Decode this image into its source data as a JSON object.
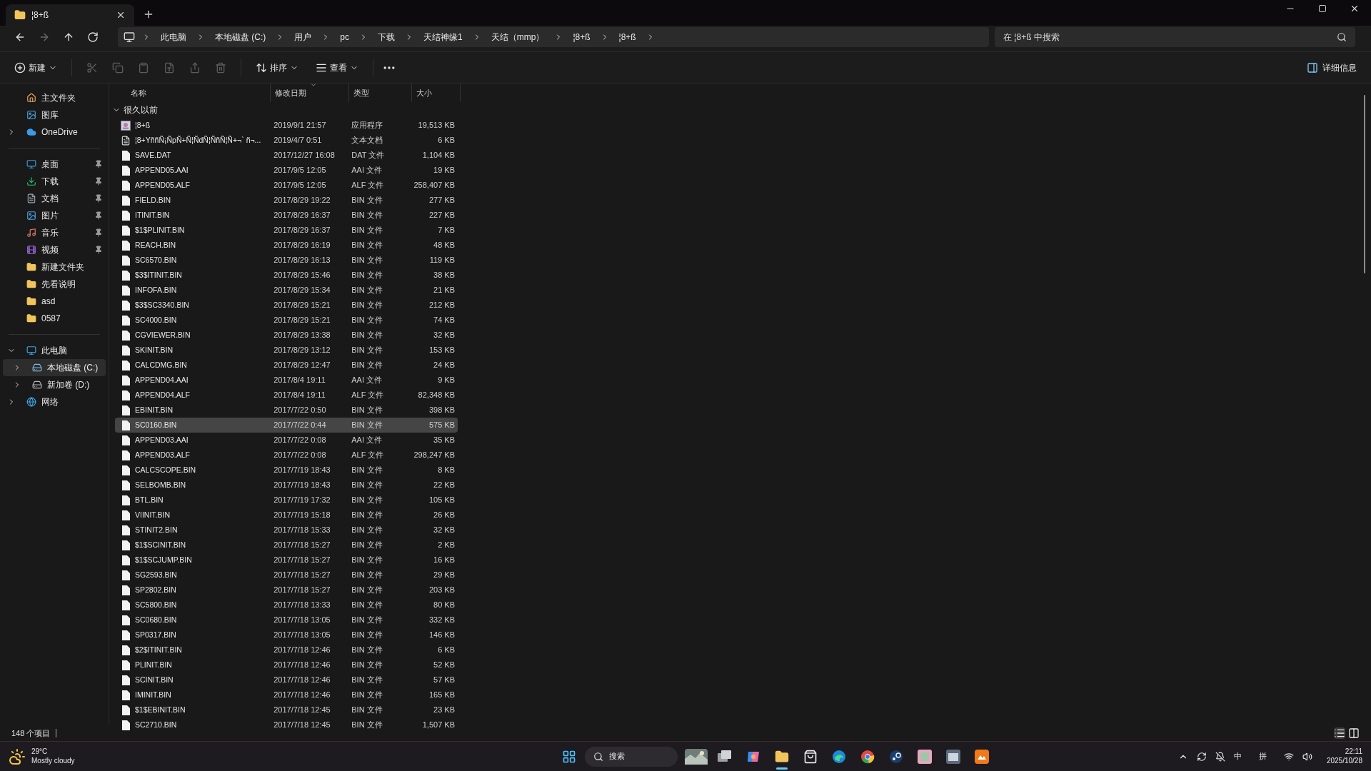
{
  "window": {
    "tab_title": "¦8+ß"
  },
  "breadcrumbs": [
    "此电脑",
    "本地磁盘 (C:)",
    "用户",
    "pc",
    "下载",
    "天结神缘1",
    "天结（mmp）",
    "¦8+ß",
    "¦8+ß"
  ],
  "search": {
    "placeholder": "在 ¦8+ß 中搜索"
  },
  "toolbar": {
    "new": "新建",
    "sort": "排序",
    "view": "查看",
    "details": "详细信息"
  },
  "sidebar": {
    "sections": [
      [
        {
          "label": "主文件夹",
          "kind": "home",
          "selected": false
        },
        {
          "label": "图库",
          "kind": "gallery",
          "selected": false
        },
        {
          "label": "OneDrive",
          "kind": "cloud",
          "expanded": false,
          "selected": false
        }
      ],
      [
        {
          "label": "桌面",
          "kind": "desktop",
          "pinned": true,
          "selected": false
        },
        {
          "label": "下载",
          "kind": "download",
          "pinned": true,
          "selected": false
        },
        {
          "label": "文档",
          "kind": "document",
          "pinned": true,
          "selected": false
        },
        {
          "label": "图片",
          "kind": "gallery",
          "pinned": true,
          "selected": false
        },
        {
          "label": "音乐",
          "kind": "music",
          "pinned": true,
          "selected": false
        },
        {
          "label": "视频",
          "kind": "video",
          "pinned": true,
          "selected": false
        },
        {
          "label": "新建文件夹",
          "kind": "folder",
          "pinned": false,
          "selected": false
        },
        {
          "label": "先看说明",
          "kind": "folder",
          "pinned": false,
          "selected": false
        },
        {
          "label": "asd",
          "kind": "folder",
          "pinned": false,
          "selected": false
        },
        {
          "label": "0587",
          "kind": "folder",
          "pinned": false,
          "selected": false
        }
      ],
      [
        {
          "label": "此电脑",
          "kind": "pc",
          "expanded": true,
          "selected": false,
          "children": [
            {
              "label": "本地磁盘 (C:)",
              "kind": "system-drive",
              "expanded": false,
              "selected": true
            },
            {
              "label": "新加卷 (D:)",
              "kind": "drive",
              "expanded": false,
              "selected": false
            }
          ]
        },
        {
          "label": "网络",
          "kind": "network",
          "expanded": false,
          "selected": false
        }
      ]
    ]
  },
  "list": {
    "columns": [
      {
        "label": "名称",
        "sorted": false
      },
      {
        "label": "修改日期",
        "sorted": true
      },
      {
        "label": "类型",
        "sorted": false
      },
      {
        "label": "大小",
        "sorted": false
      }
    ],
    "group": {
      "label": "很久以前",
      "expanded": true
    },
    "rows": [
      {
        "name": "¦8+ß",
        "date": "2019/9/1 21:57",
        "type": "应用程序",
        "size": "19,513 KB",
        "kind": "app",
        "selected": false
      },
      {
        "name": "¦8+YññÑ¡ÑpÑ+Ñ¦ÑdÑ¦ÑñÑ¦Ñ+¬` ñ¬...",
        "date": "2019/4/7 0:51",
        "type": "文本文档",
        "size": "6 KB",
        "kind": "text",
        "selected": false
      },
      {
        "name": "SAVE.DAT",
        "date": "2017/12/27 16:08",
        "type": "DAT 文件",
        "size": "1,104 KB",
        "kind": "file",
        "selected": false
      },
      {
        "name": "APPEND05.AAI",
        "date": "2017/9/5 12:05",
        "type": "AAI 文件",
        "size": "19 KB",
        "kind": "file",
        "selected": false
      },
      {
        "name": "APPEND05.ALF",
        "date": "2017/9/5 12:05",
        "type": "ALF 文件",
        "size": "258,407 KB",
        "kind": "file",
        "selected": false
      },
      {
        "name": "FIELD.BIN",
        "date": "2017/8/29 19:22",
        "type": "BIN 文件",
        "size": "277 KB",
        "kind": "file",
        "selected": false
      },
      {
        "name": "ITINIT.BIN",
        "date": "2017/8/29 16:37",
        "type": "BIN 文件",
        "size": "227 KB",
        "kind": "file",
        "selected": false
      },
      {
        "name": "$1$PLINIT.BIN",
        "date": "2017/8/29 16:37",
        "type": "BIN 文件",
        "size": "7 KB",
        "kind": "file",
        "selected": false
      },
      {
        "name": "REACH.BIN",
        "date": "2017/8/29 16:19",
        "type": "BIN 文件",
        "size": "48 KB",
        "kind": "file",
        "selected": false
      },
      {
        "name": "SC6570.BIN",
        "date": "2017/8/29 16:13",
        "type": "BIN 文件",
        "size": "119 KB",
        "kind": "file",
        "selected": false
      },
      {
        "name": "$3$ITINIT.BIN",
        "date": "2017/8/29 15:46",
        "type": "BIN 文件",
        "size": "38 KB",
        "kind": "file",
        "selected": false
      },
      {
        "name": "INFOFA.BIN",
        "date": "2017/8/29 15:34",
        "type": "BIN 文件",
        "size": "21 KB",
        "kind": "file",
        "selected": false
      },
      {
        "name": "$3$SC3340.BIN",
        "date": "2017/8/29 15:21",
        "type": "BIN 文件",
        "size": "212 KB",
        "kind": "file",
        "selected": false
      },
      {
        "name": "SC4000.BIN",
        "date": "2017/8/29 15:21",
        "type": "BIN 文件",
        "size": "74 KB",
        "kind": "file",
        "selected": false
      },
      {
        "name": "CGVIEWER.BIN",
        "date": "2017/8/29 13:38",
        "type": "BIN 文件",
        "size": "32 KB",
        "kind": "file",
        "selected": false
      },
      {
        "name": "SKINIT.BIN",
        "date": "2017/8/29 13:12",
        "type": "BIN 文件",
        "size": "153 KB",
        "kind": "file",
        "selected": false
      },
      {
        "name": "CALCDMG.BIN",
        "date": "2017/8/29 12:47",
        "type": "BIN 文件",
        "size": "24 KB",
        "kind": "file",
        "selected": false
      },
      {
        "name": "APPEND04.AAI",
        "date": "2017/8/4 19:11",
        "type": "AAI 文件",
        "size": "9 KB",
        "kind": "file",
        "selected": false
      },
      {
        "name": "APPEND04.ALF",
        "date": "2017/8/4 19:11",
        "type": "ALF 文件",
        "size": "82,348 KB",
        "kind": "file",
        "selected": false
      },
      {
        "name": "EBINIT.BIN",
        "date": "2017/7/22 0:50",
        "type": "BIN 文件",
        "size": "398 KB",
        "kind": "file",
        "selected": false
      },
      {
        "name": "SC0160.BIN",
        "date": "2017/7/22 0:44",
        "type": "BIN 文件",
        "size": "575 KB",
        "kind": "file",
        "selected": true
      },
      {
        "name": "APPEND03.AAI",
        "date": "2017/7/22 0:08",
        "type": "AAI 文件",
        "size": "35 KB",
        "kind": "file",
        "selected": false
      },
      {
        "name": "APPEND03.ALF",
        "date": "2017/7/22 0:08",
        "type": "ALF 文件",
        "size": "298,247 KB",
        "kind": "file",
        "selected": false
      },
      {
        "name": "CALCSCOPE.BIN",
        "date": "2017/7/19 18:43",
        "type": "BIN 文件",
        "size": "8 KB",
        "kind": "file",
        "selected": false
      },
      {
        "name": "SELBOMB.BIN",
        "date": "2017/7/19 18:43",
        "type": "BIN 文件",
        "size": "22 KB",
        "kind": "file",
        "selected": false
      },
      {
        "name": "BTL.BIN",
        "date": "2017/7/19 17:32",
        "type": "BIN 文件",
        "size": "105 KB",
        "kind": "file",
        "selected": false
      },
      {
        "name": "VIINIT.BIN",
        "date": "2017/7/19 15:18",
        "type": "BIN 文件",
        "size": "26 KB",
        "kind": "file",
        "selected": false
      },
      {
        "name": "STINIT2.BIN",
        "date": "2017/7/18 15:33",
        "type": "BIN 文件",
        "size": "32 KB",
        "kind": "file",
        "selected": false
      },
      {
        "name": "$1$SCINIT.BIN",
        "date": "2017/7/18 15:27",
        "type": "BIN 文件",
        "size": "2 KB",
        "kind": "file",
        "selected": false
      },
      {
        "name": "$1$SCJUMP.BIN",
        "date": "2017/7/18 15:27",
        "type": "BIN 文件",
        "size": "16 KB",
        "kind": "file",
        "selected": false
      },
      {
        "name": "SG2593.BIN",
        "date": "2017/7/18 15:27",
        "type": "BIN 文件",
        "size": "29 KB",
        "kind": "file",
        "selected": false
      },
      {
        "name": "SP2802.BIN",
        "date": "2017/7/18 15:27",
        "type": "BIN 文件",
        "size": "203 KB",
        "kind": "file",
        "selected": false
      },
      {
        "name": "SC5800.BIN",
        "date": "2017/7/18 13:33",
        "type": "BIN 文件",
        "size": "80 KB",
        "kind": "file",
        "selected": false
      },
      {
        "name": "SC0680.BIN",
        "date": "2017/7/18 13:05",
        "type": "BIN 文件",
        "size": "332 KB",
        "kind": "file",
        "selected": false
      },
      {
        "name": "SP0317.BIN",
        "date": "2017/7/18 13:05",
        "type": "BIN 文件",
        "size": "146 KB",
        "kind": "file",
        "selected": false
      },
      {
        "name": "$2$ITINIT.BIN",
        "date": "2017/7/18 12:46",
        "type": "BIN 文件",
        "size": "6 KB",
        "kind": "file",
        "selected": false
      },
      {
        "name": "PLINIT.BIN",
        "date": "2017/7/18 12:46",
        "type": "BIN 文件",
        "size": "52 KB",
        "kind": "file",
        "selected": false
      },
      {
        "name": "SCINIT.BIN",
        "date": "2017/7/18 12:46",
        "type": "BIN 文件",
        "size": "57 KB",
        "kind": "file",
        "selected": false
      },
      {
        "name": "IMINIT.BIN",
        "date": "2017/7/18 12:46",
        "type": "BIN 文件",
        "size": "165 KB",
        "kind": "file",
        "selected": false
      },
      {
        "name": "$1$EBINIT.BIN",
        "date": "2017/7/18 12:45",
        "type": "BIN 文件",
        "size": "23 KB",
        "kind": "file",
        "selected": false
      },
      {
        "name": "SC2710.BIN",
        "date": "2017/7/18 12:45",
        "type": "BIN 文件",
        "size": "1,507 KB",
        "kind": "file",
        "selected": false
      }
    ]
  },
  "status_bar": {
    "count": "148 个项目"
  },
  "taskbar": {
    "weather": {
      "temp": "29°C",
      "condition": "Mostly cloudy"
    },
    "search": "搜索",
    "apps": [
      {
        "kind": "widget",
        "active": false
      },
      {
        "kind": "taskview",
        "active": false
      },
      {
        "kind": "copilot",
        "active": false
      },
      {
        "kind": "explorer",
        "active": true
      },
      {
        "kind": "store",
        "active": false
      },
      {
        "kind": "edge",
        "active": false
      },
      {
        "kind": "chrome",
        "active": false
      },
      {
        "kind": "steam",
        "active": false
      },
      {
        "kind": "pink-app",
        "active": false
      },
      {
        "kind": "window-app",
        "active": false
      },
      {
        "kind": "orange-app",
        "active": false
      }
    ],
    "tray": {
      "ime_lang": "中",
      "ime_mode": "拼",
      "time": "22:11",
      "date": "2025/10/28"
    }
  }
}
